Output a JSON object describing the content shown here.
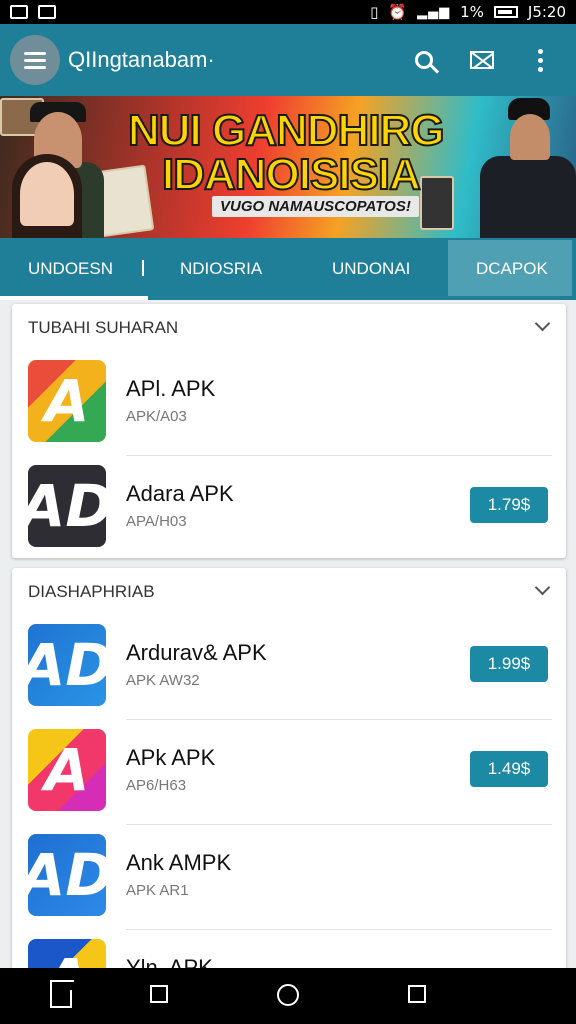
{
  "status_bar": {
    "time": "J5:20",
    "battery": "1%"
  },
  "app_bar": {
    "title": "QIIngtanabam·"
  },
  "banner": {
    "title_line1": "NUI GANDHIRG",
    "title_line2": "IDANOISISIA",
    "subtitle": "VUGO NAMAUSCOPATOS!"
  },
  "tabs": [
    {
      "label": "UNDOESN"
    },
    {
      "label": "NDIOSRIA"
    },
    {
      "label": "UNDONAI"
    },
    {
      "label": "DCAPOK"
    }
  ],
  "groups": [
    {
      "title": "TUBAHI SUHARAN",
      "items": [
        {
          "name": "APl. APK",
          "sub": "APK/A03",
          "price": "",
          "icon_letter": "A",
          "icon_colors": [
            "#e94e3a",
            "#f3b21c",
            "#34a853"
          ]
        },
        {
          "name": "Adara APK",
          "sub": "APA/H03",
          "price": "1.79$",
          "icon_letter": "AD",
          "icon_colors": [
            "#2d2d33",
            "#2d2d33",
            "#2d2d33"
          ]
        }
      ]
    },
    {
      "title": "DIASHAPHRIAB",
      "items": [
        {
          "name": "Ardurav& APK",
          "sub": "APK AW32",
          "price": "1.99$",
          "icon_letter": "AD",
          "icon_colors": [
            "#1f74d1",
            "#2a94e6",
            "#1f74d1"
          ]
        },
        {
          "name": "APk APK",
          "sub": "AP6/H63",
          "price": "1.49$",
          "icon_letter": "A",
          "icon_colors": [
            "#f5c518",
            "#f2376b",
            "#d62db6"
          ]
        },
        {
          "name": "Ank AMPK",
          "sub": "APK AR1",
          "price": "",
          "icon_letter": "AD",
          "icon_colors": [
            "#1e6fd0",
            "#2d8ae8",
            "#1e6fd0"
          ]
        },
        {
          "name": "Yln. APK",
          "sub": "",
          "price": "",
          "icon_letter": "A",
          "icon_colors": [
            "#1b57c8",
            "#f5c518",
            "#34a853"
          ]
        }
      ]
    }
  ],
  "icons": [
    "menu-icon",
    "search-icon",
    "mail-icon",
    "more-vert-icon",
    "chevron-down-icon",
    "home-icon",
    "back-icon",
    "circle-home-icon",
    "recents-icon"
  ]
}
